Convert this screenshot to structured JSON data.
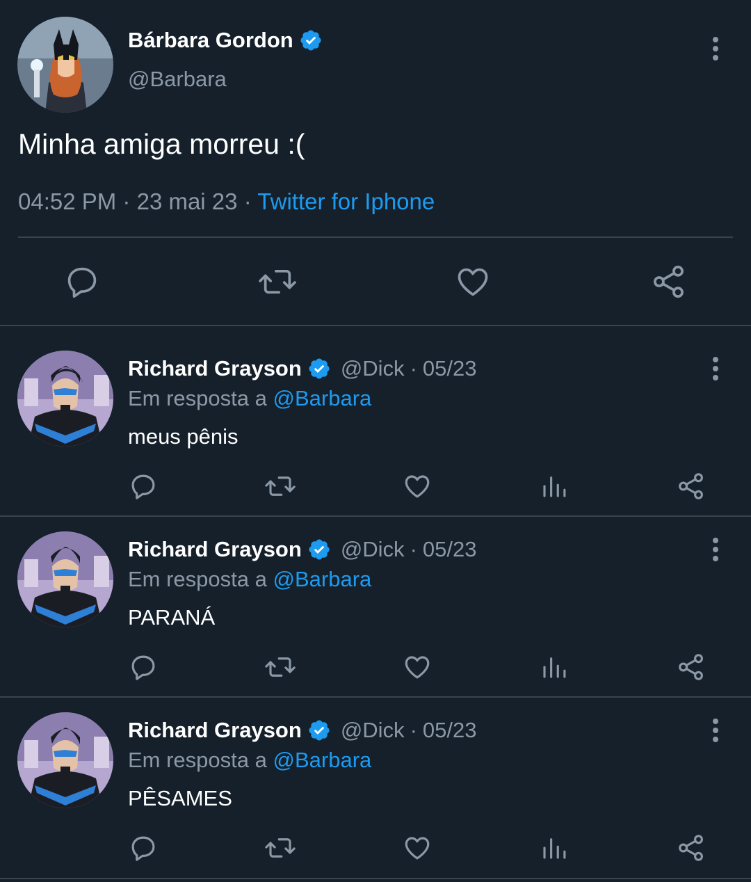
{
  "main_tweet": {
    "author_name": "Bárbara Gordon",
    "author_handle": "@Barbara",
    "verified": true,
    "text": "Minha amiga morreu :(",
    "time": "04:52 PM",
    "date": "23 mai 23",
    "separator": "·",
    "source": "Twitter for Iphone",
    "actions": [
      "reply-icon",
      "retweet-icon",
      "like-icon",
      "share-icon"
    ]
  },
  "reply_prefix": "Em resposta a",
  "replies": [
    {
      "author_name": "Richard Grayson",
      "author_handle": "@Dick",
      "date": "05/23",
      "reply_to": "@Barbara",
      "text": "meus pênis"
    },
    {
      "author_name": "Richard Grayson",
      "author_handle": "@Dick",
      "date": "05/23",
      "reply_to": "@Barbara",
      "text": "PARANÁ"
    },
    {
      "author_name": "Richard Grayson",
      "author_handle": "@Dick",
      "date": "05/23",
      "reply_to": "@Barbara",
      "text": "PÊSAMES"
    }
  ],
  "reply_actions": [
    "reply-icon",
    "retweet-icon",
    "like-icon",
    "views-icon",
    "share-icon"
  ],
  "colors": {
    "background": "#15202b",
    "accent": "#1d9bf0",
    "secondary_text": "#8b98a5",
    "divider": "#38444d"
  }
}
